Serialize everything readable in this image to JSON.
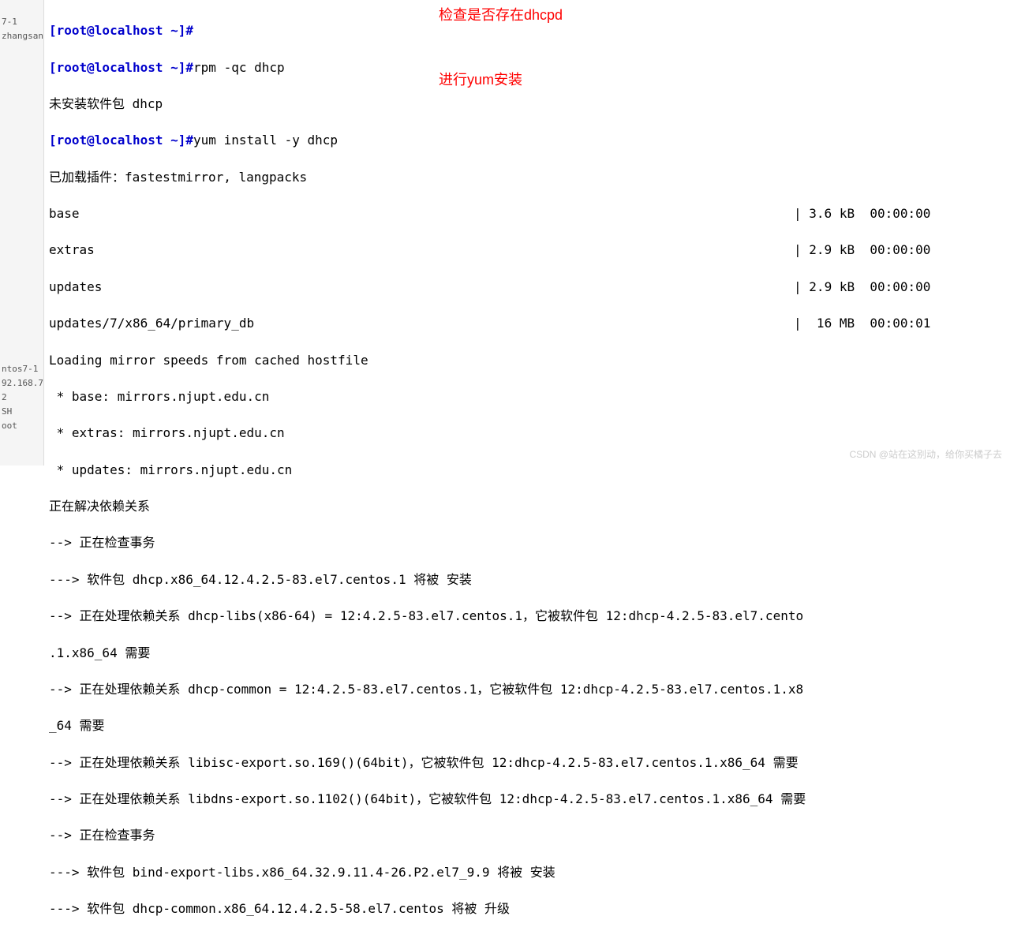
{
  "sidebar": {
    "top_items": [
      "7-1",
      "zhangsan"
    ],
    "bottom_items": [
      "ntos7-1",
      "92.168.7..",
      "2",
      "SH",
      "oot"
    ]
  },
  "annotations": {
    "check_dhcpd": "检查是否存在dhcpd",
    "yum_install": "进行yum安装"
  },
  "prompts": {
    "p1": "[root@localhost ~]#",
    "p2": "[root@localhost ~]#",
    "p3": "[root@localhost ~]#"
  },
  "commands": {
    "cmd2": "rpm -qc dhcp",
    "cmd3": "yum install -y dhcp"
  },
  "output": {
    "not_installed": "未安装软件包 dhcp",
    "plugins": "已加载插件：fastestmirror, langpacks",
    "repo_lines": [
      {
        "name": "base",
        "size": "3.6 kB",
        "time": "00:00:00"
      },
      {
        "name": "extras",
        "size": "2.9 kB",
        "time": "00:00:00"
      },
      {
        "name": "updates",
        "size": "2.9 kB",
        "time": "00:00:00"
      },
      {
        "name": "updates/7/x86_64/primary_db",
        "size": " 16 MB",
        "time": "00:00:01"
      }
    ],
    "mirror_header": "Loading mirror speeds from cached hostfile",
    "mirrors": [
      " * base: mirrors.njupt.edu.cn",
      " * extras: mirrors.njupt.edu.cn",
      " * updates: mirrors.njupt.edu.cn"
    ],
    "resolving": "正在解决依赖关系",
    "trans1": "--> 正在检查事务",
    "dep_lines": [
      "---> 软件包 dhcp.x86_64.12.4.2.5-83.el7.centos.1 将被 安装",
      "--> 正在处理依赖关系 dhcp-libs(x86-64) = 12:4.2.5-83.el7.centos.1，它被软件包 12:dhcp-4.2.5-83.el7.cento",
      ".1.x86_64 需要",
      "--> 正在处理依赖关系 dhcp-common = 12:4.2.5-83.el7.centos.1，它被软件包 12:dhcp-4.2.5-83.el7.centos.1.x8",
      "_64 需要",
      "--> 正在处理依赖关系 libisc-export.so.169()(64bit)，它被软件包 12:dhcp-4.2.5-83.el7.centos.1.x86_64 需要",
      "--> 正在处理依赖关系 libdns-export.so.1102()(64bit)，它被软件包 12:dhcp-4.2.5-83.el7.centos.1.x86_64 需要",
      "--> 正在检查事务",
      "---> 软件包 bind-export-libs.x86_64.32.9.11.4-26.P2.el7_9.9 将被 安装",
      "---> 软件包 dhcp-common.x86_64.12.4.2.5-58.el7.centos 将被 升级"
    ]
  },
  "watermark": "CSDN @站在这别动，给你买橘子去"
}
